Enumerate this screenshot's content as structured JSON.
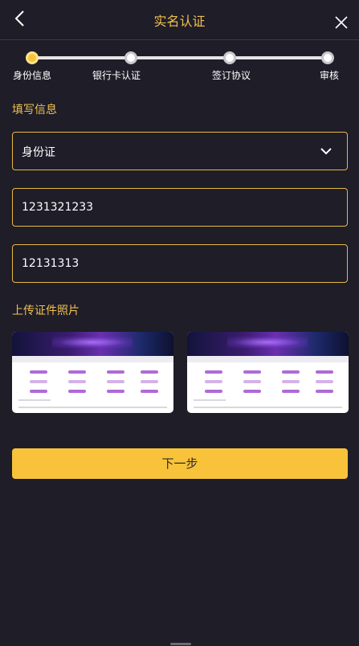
{
  "header": {
    "title": "实名认证",
    "back_icon": "chevron-left-icon",
    "close_icon": "close-icon"
  },
  "steps": [
    {
      "label": "身份信息",
      "active": true
    },
    {
      "label": "银行卡认证",
      "active": false
    },
    {
      "label": "签订协议",
      "active": false
    },
    {
      "label": "审核",
      "active": false
    }
  ],
  "form": {
    "section_title": "填写信息",
    "id_type": {
      "value": "身份证",
      "icon": "chevron-down-icon"
    },
    "field_1": {
      "value": "1231321233"
    },
    "field_2": {
      "value": "12131313"
    }
  },
  "upload": {
    "section_title": "上传证件照片",
    "photos": [
      "id-photo-front",
      "id-photo-back"
    ]
  },
  "next_button": {
    "label": "下一步"
  },
  "colors": {
    "background": "#1e1d28",
    "accent": "#f0c050",
    "button": "#f8c33a",
    "field_border": "#e8b843"
  }
}
